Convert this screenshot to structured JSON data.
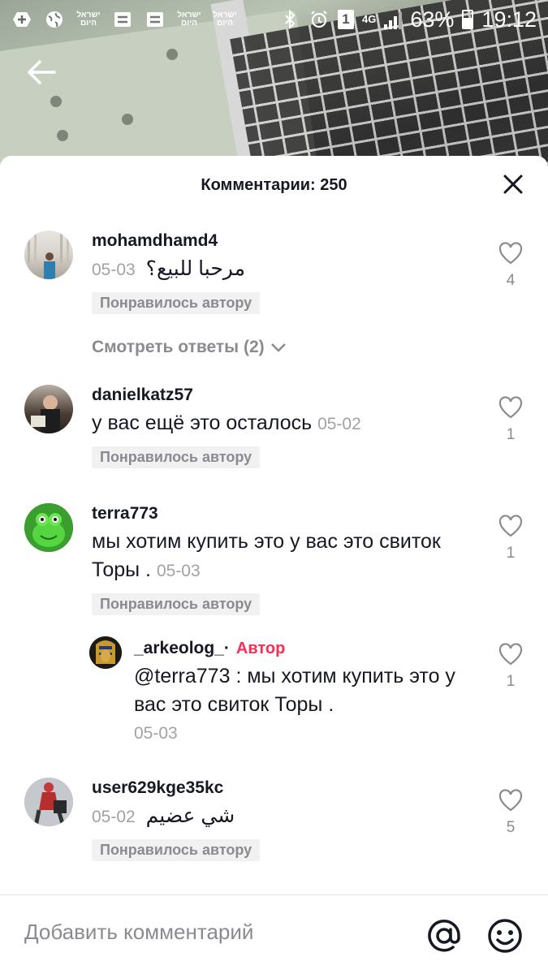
{
  "status_bar": {
    "battery": "63%",
    "time": "19:12",
    "sim_slot": "1",
    "network": "4G",
    "hebrew_badge_top": "ישראל",
    "hebrew_badge_bottom": "היום"
  },
  "sheet": {
    "title": "Комментарии: 250"
  },
  "comments": [
    {
      "username": "mohamdhamd4",
      "text": "مرحبا للبيع؟",
      "date": "05-03",
      "badge": "Понравилось автору",
      "likes": "4",
      "view_replies": "Смотреть ответы (2)"
    },
    {
      "username": "danielkatz57",
      "text": "у вас ещё это осталось",
      "date": "05-02",
      "badge": "Понравилось автору",
      "likes": "1"
    },
    {
      "username": "terra773",
      "text": "мы хотим купить это у вас это свиток Торы .",
      "date": "05-03",
      "badge": "Понравилось автору",
      "likes": "1"
    },
    {
      "username": "user629kge35kc",
      "text": "شي عضيم",
      "date": "05-02",
      "badge": "Понравилось автору",
      "likes": "5"
    }
  ],
  "reply": {
    "username": "_arkeolog_·",
    "author_label": "Автор",
    "text": "@terra773 : мы хотим купить это у вас это свиток Торы .",
    "date": "05-03",
    "likes": "1"
  },
  "composer": {
    "placeholder": "Добавить комментарий"
  },
  "colors": {
    "accent": "#fe2c55",
    "muted": "#8a8b91",
    "badge_bg": "#f1f1f2"
  }
}
